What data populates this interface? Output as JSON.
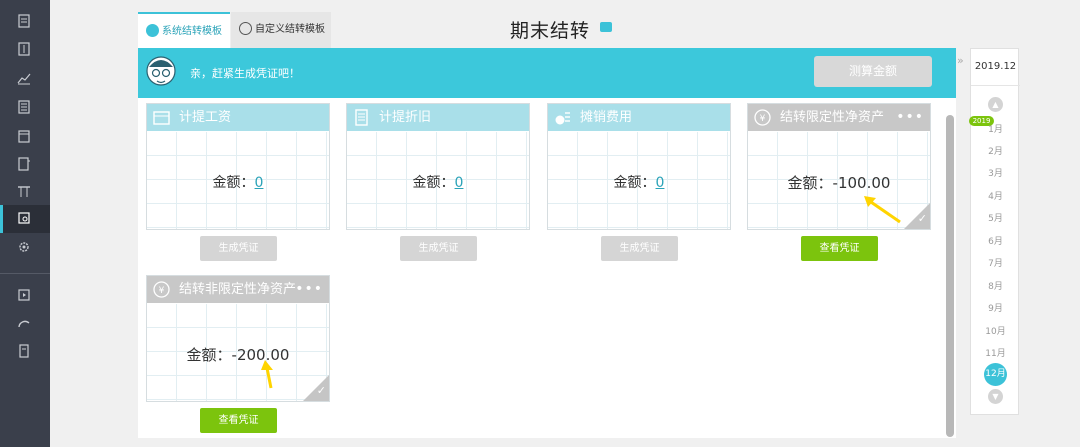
{
  "tabs": [
    {
      "label": "系统结转模板"
    },
    {
      "label": "自定义结转模板"
    }
  ],
  "page": {
    "title": "期末结转"
  },
  "banner": {
    "message": "亲，赶紧生成凭证吧！",
    "calc_button": "测算金额"
  },
  "amount_label": "金额：",
  "cards": [
    {
      "title": "计提工资",
      "value": "0",
      "button": "生成凭证"
    },
    {
      "title": "计提折旧",
      "value": "0",
      "button": "生成凭证"
    },
    {
      "title": "摊销费用",
      "value": "0",
      "button": "生成凭证"
    },
    {
      "title": "结转限定性净资产",
      "value": "-100.00",
      "button": "查看凭证"
    },
    {
      "title": "结转非限定性净资产",
      "value": "-200.00",
      "button": "查看凭证"
    }
  ],
  "period": {
    "selected": "2019.12",
    "year_badge": "2019",
    "months": [
      "1月",
      "2月",
      "3月",
      "4月",
      "5月",
      "6月",
      "7月",
      "8月",
      "9月",
      "10月",
      "11月",
      "12月"
    ],
    "current_month": "12月"
  },
  "colors": {
    "accent": "#3cc2d8",
    "banner": "#3cc8db",
    "green": "#7cc40d",
    "nav": "#3a3f4b",
    "arrow": "#ffd400"
  }
}
